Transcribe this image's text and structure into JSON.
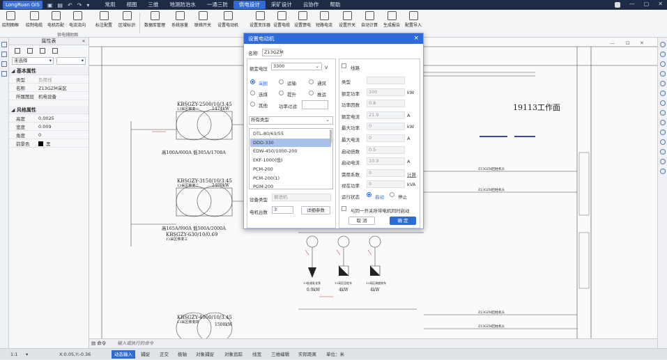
{
  "app": {
    "logo": "LongRuan GIS"
  },
  "menu": [
    "常用",
    "视图",
    "三维",
    "地测防治水",
    "一通三防",
    "供电设计",
    "采矿设计",
    "云协作",
    "帮助"
  ],
  "ribbon": {
    "items": [
      "绘制图框",
      "绘制电缆",
      "电机匹配",
      "电流流向",
      "标注配置",
      "区域标识",
      "数据库管理",
      "系统容量",
      "联络开关",
      "设置电动机",
      "设置变压器",
      "设置电缆",
      "设置馈电",
      "短路电流",
      "设置开关",
      "自动计算",
      "生成报告",
      "配置导入"
    ],
    "group": "供电辅助图"
  },
  "panel": {
    "title": "属性表",
    "select": "未选择",
    "section1": "基本属性",
    "props1": [
      {
        "k": "类型",
        "v": "负荷线"
      },
      {
        "k": "名称",
        "v": "Z13GZM采区"
      },
      {
        "k": "所属图层",
        "v": "机电设备"
      }
    ],
    "section2": "风格属性",
    "props2": [
      {
        "k": "高度",
        "v": "0.0025"
      },
      {
        "k": "宽度",
        "v": "0.009"
      },
      {
        "k": "角度",
        "v": "0"
      },
      {
        "k": "前景色",
        "v": "黑"
      }
    ]
  },
  "canvas": {
    "workface": "19113工作面",
    "t1": {
      "name": "KBSGZY-2500/10/3.45",
      "sub": "13采区移变一",
      "kw": "1474kW",
      "a": "高100A/600A  低305A/1708A"
    },
    "t2": {
      "name": "KBSGZY-3150/10/3.45",
      "sub": "13采区移变二",
      "kw": "2400kW",
      "a": "高165A/990A  低500A/2000A"
    },
    "t3": {
      "name": "KBSGZY-630/10/0.69",
      "sub": "13采区移变三"
    },
    "t4": {
      "name": "KBSGZY-4000/10/3.45",
      "sub": "13采区移变四",
      "kw": "1500kW"
    },
    "cable": "Z13GZM回柱机头",
    "kwlabels": [
      "0.9kW",
      "4kW",
      "4kW"
    ],
    "loads": [
      "13轨道乳化泵",
      "13采区回柱车",
      "13采区调度绞车"
    ]
  },
  "command": {
    "label": "命令",
    "placeholder": "输入或执行的命令"
  },
  "status": {
    "scale": "1:1",
    "coord": "X:0.05,Y:-0.36",
    "items": [
      "动态输入",
      "捕捉",
      "正交",
      "极轴",
      "对象捕捉",
      "对象追踪",
      "线宽",
      "三维编辑",
      "实际距离",
      "单位：米"
    ]
  },
  "dialog": {
    "title": "设置电动机",
    "name_label": "名称",
    "name_value": "Z13GZM",
    "voltage_label": "额定电压",
    "voltage_value": "3300",
    "voltage_unit": "V",
    "radios": [
      {
        "label": "采掘",
        "on": true
      },
      {
        "label": "运输",
        "on": false
      },
      {
        "label": "通风",
        "on": false
      },
      {
        "label": "选煤",
        "on": false
      },
      {
        "label": "提升",
        "on": false
      },
      {
        "label": "推运",
        "on": false
      },
      {
        "label": "其他",
        "on": false
      }
    ],
    "filter_label": "功率过滤",
    "filter_value": "",
    "type_select": "所有类型",
    "list": [
      "DTL-80/63/55",
      "DDD-330",
      "EDW-450/1000-200",
      "EKF-1000(低)",
      "PCM-200",
      "PCM-200(1)",
      "PGM-200"
    ],
    "list_selected": 1,
    "devtype_label": "设备类型",
    "devtype_value": "掘进机",
    "count_label": "电机台数",
    "count_value": "3",
    "detail_button": "详细参数",
    "line_label": "线路",
    "fields": [
      {
        "k": "类型",
        "v": "",
        "u": ""
      },
      {
        "k": "额定功率",
        "v": "100",
        "u": "kW"
      },
      {
        "k": "功率因数",
        "v": "0.8",
        "u": ""
      },
      {
        "k": "额定电流",
        "v": "21.9",
        "u": "A"
      },
      {
        "k": "最大功率",
        "v": "0",
        "u": "kW"
      },
      {
        "k": "最大电流",
        "v": "0",
        "u": "A"
      },
      {
        "k": "启动倍数",
        "v": "0.5",
        "u": ""
      },
      {
        "k": "启动电流",
        "v": "10.9",
        "u": "A"
      },
      {
        "k": "需用系数",
        "v": "0",
        "u": "计算"
      },
      {
        "k": "视在功率",
        "v": "0",
        "u": "kVA"
      }
    ],
    "run_label": "运行状态",
    "run_on": "启动",
    "run_off": "停止",
    "linked_label": "与同一开关所带电机同时启动",
    "cancel": "取 消",
    "ok": "确 定"
  }
}
